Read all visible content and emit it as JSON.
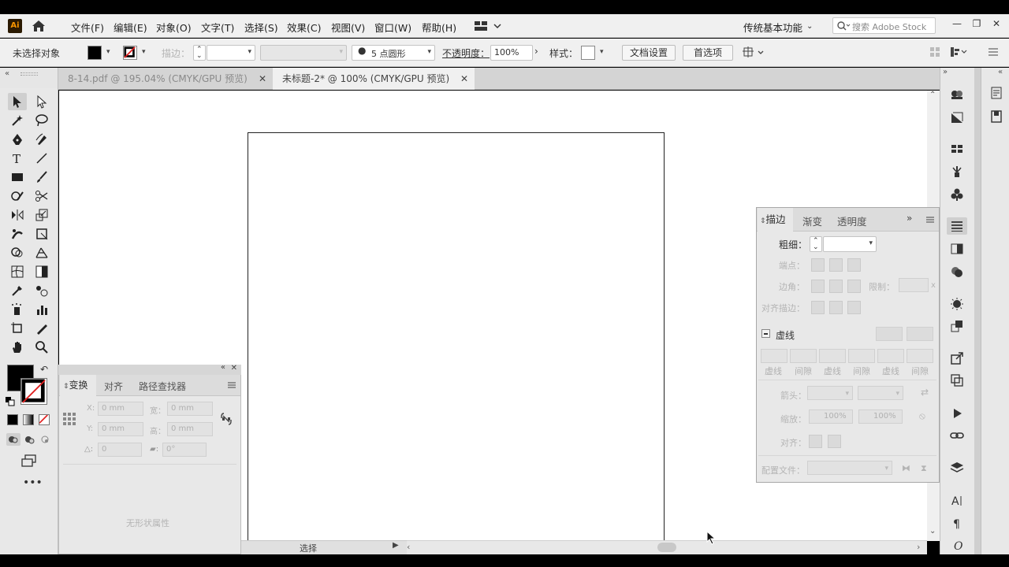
{
  "app": {
    "logo": "Ai"
  },
  "menus": [
    "文件(F)",
    "编辑(E)",
    "对象(O)",
    "文字(T)",
    "选择(S)",
    "效果(C)",
    "视图(V)",
    "窗口(W)",
    "帮助(H)"
  ],
  "workspace": {
    "name": "传统基本功能"
  },
  "search": {
    "placeholder": "搜索 Adobe Stock"
  },
  "window_controls": {
    "minimize": "—",
    "restore": "❐",
    "close": "✕"
  },
  "control_bar": {
    "selection_status": "未选择对象",
    "stroke_label": "描边：",
    "brush_label": "5 点圆形",
    "opacity_label": "不透明度：",
    "opacity_value": "100%",
    "style_label": "样式：",
    "doc_setup_button": "文档设置",
    "preferences_button": "首选项"
  },
  "tabs": [
    {
      "label": "8-14.pdf @ 195.04% (CMYK/GPU 预览)",
      "active": false
    },
    {
      "label": "未标题-2* @ 100% (CMYK/GPU 预览)",
      "active": true
    }
  ],
  "transform_panel": {
    "tabs": [
      "变换",
      "对齐",
      "路径查找器"
    ],
    "x_label": "X:",
    "x_value": "0 mm",
    "y_label": "Y:",
    "y_value": "0 mm",
    "w_label": "宽：",
    "w_value": "0 mm",
    "h_label": "高：",
    "h_value": "0 mm",
    "angle_value": "0",
    "shear_value": "0°",
    "no_shape": "无形状属性"
  },
  "stroke_panel": {
    "tabs": [
      "描边",
      "渐变",
      "透明度"
    ],
    "weight_label": "粗细：",
    "cap_label": "端点：",
    "corner_label": "边角：",
    "limit_label": "限制：",
    "limit_suffix": "x",
    "align_label": "对齐描边：",
    "dashed_label": "虚线",
    "dash_labels": [
      "虚线",
      "间隙",
      "虚线",
      "间隙",
      "虚线",
      "间隙"
    ],
    "arrow_label": "箭头：",
    "scale_label": "缩放：",
    "scale_values": [
      "100%",
      "100%"
    ],
    "align2_label": "对齐：",
    "profile_label": "配置文件："
  },
  "status_bar": {
    "tool": "选择"
  },
  "colors": {
    "chrome": "#f0f0f0",
    "panel": "#e8e8e8",
    "canvas": "#ffffff",
    "fill": "#000000",
    "none_slash": "#e02020"
  }
}
